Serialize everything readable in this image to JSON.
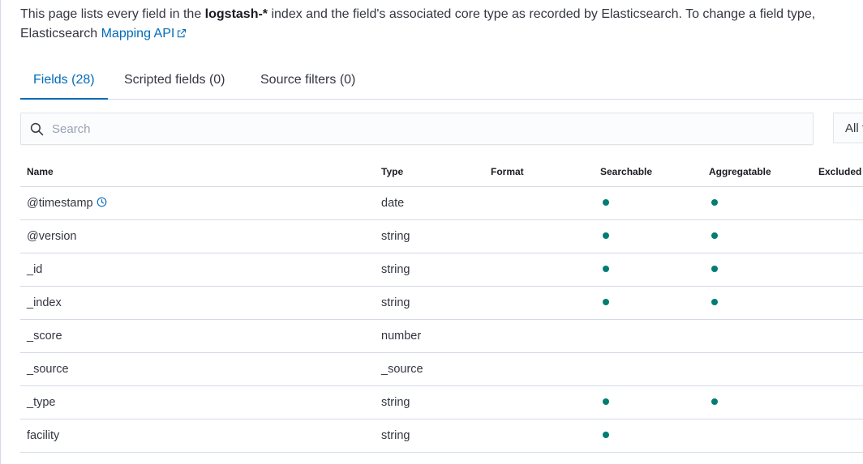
{
  "description": {
    "text_before": "This page lists every field in the ",
    "index_name": "logstash-*",
    "text_after": " index and the field's associated core type as recorded by Elasticsearch. To change a field type,",
    "line2_prefix": "Elasticsearch ",
    "link_label": "Mapping API"
  },
  "tabs": [
    {
      "label": "Fields (28)",
      "active": true
    },
    {
      "label": "Scripted fields (0)",
      "active": false
    },
    {
      "label": "Source filters (0)",
      "active": false
    }
  ],
  "search": {
    "placeholder": "Search"
  },
  "filter": {
    "selected": "All field types"
  },
  "table": {
    "headers": {
      "name": "Name",
      "type": "Type",
      "format": "Format",
      "searchable": "Searchable",
      "aggregatable": "Aggregatable",
      "excluded": "Excluded"
    },
    "rows": [
      {
        "name": "@timestamp",
        "type": "date",
        "format": "",
        "searchable": true,
        "aggregatable": true,
        "timestamp_icon": true
      },
      {
        "name": "@version",
        "type": "string",
        "format": "",
        "searchable": true,
        "aggregatable": true
      },
      {
        "name": "_id",
        "type": "string",
        "format": "",
        "searchable": true,
        "aggregatable": true
      },
      {
        "name": "_index",
        "type": "string",
        "format": "",
        "searchable": true,
        "aggregatable": true
      },
      {
        "name": "_score",
        "type": "number",
        "format": "",
        "searchable": false,
        "aggregatable": false
      },
      {
        "name": "_source",
        "type": "_source",
        "format": "",
        "searchable": false,
        "aggregatable": false
      },
      {
        "name": "_type",
        "type": "string",
        "format": "",
        "searchable": true,
        "aggregatable": true
      },
      {
        "name": "facility",
        "type": "string",
        "format": "",
        "searchable": true,
        "aggregatable": false
      }
    ]
  },
  "colors": {
    "accent": "#006bb8",
    "indicator": "#017d73",
    "border": "#d3dae6"
  },
  "icons": {
    "search": "search-icon",
    "external_link": "external-link-icon",
    "timestamp": "clock-icon"
  }
}
